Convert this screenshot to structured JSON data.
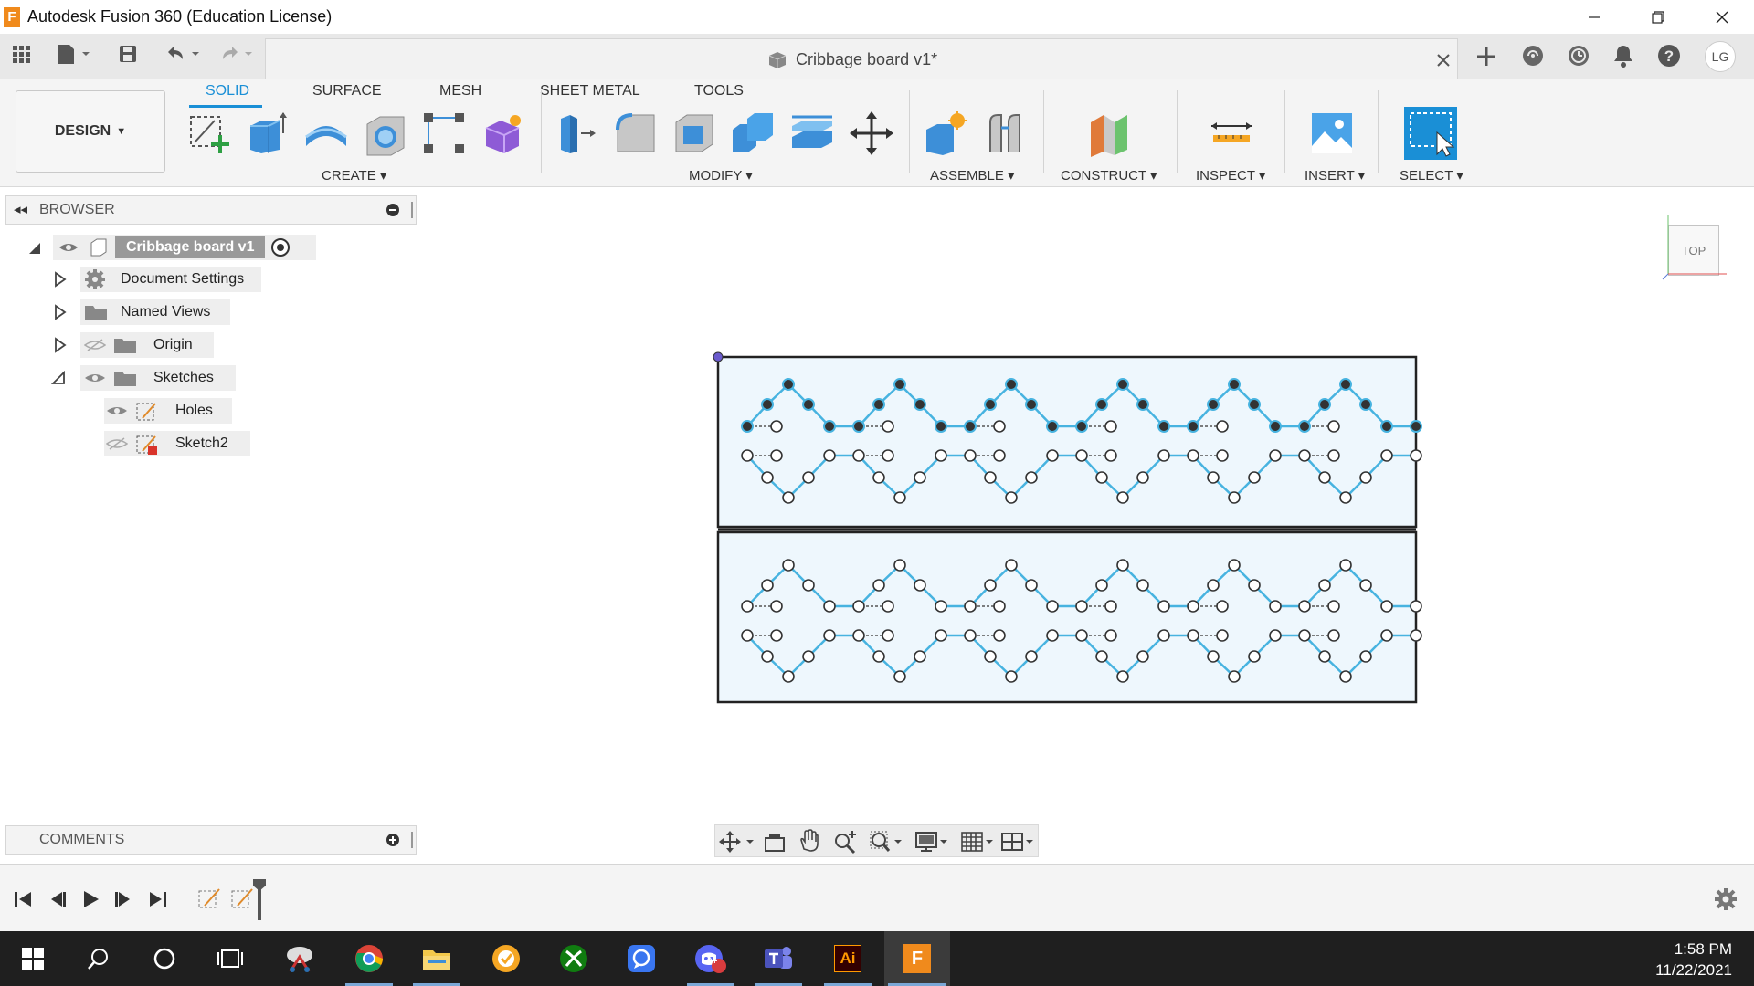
{
  "window": {
    "title": "Autodesk Fusion 360 (Education License)",
    "logo_letter": "F"
  },
  "document": {
    "tab_title": "Cribbage board v1*"
  },
  "quick_access": {
    "user_initials": "LG"
  },
  "ribbon": {
    "tabs": [
      "SOLID",
      "SURFACE",
      "MESH",
      "SHEET METAL",
      "TOOLS"
    ],
    "active_tab": "SOLID",
    "workspace": "DESIGN",
    "groups": [
      "CREATE",
      "MODIFY",
      "ASSEMBLE",
      "CONSTRUCT",
      "INSPECT",
      "INSERT",
      "SELECT"
    ]
  },
  "browser": {
    "title": "BROWSER",
    "root": "Cribbage board v1",
    "items": [
      "Document Settings",
      "Named Views",
      "Origin",
      "Sketches"
    ],
    "sketches": [
      "Holes",
      "Sketch2"
    ]
  },
  "viewcube": {
    "face": "TOP"
  },
  "comments": {
    "title": "COMMENTS"
  },
  "taskbar": {
    "time": "1:58 PM",
    "date": "11/22/2021",
    "apps": [
      "start-icon",
      "search-icon",
      "cortana-icon",
      "task-view-icon",
      "snip-icon",
      "chrome-icon",
      "file-explorer-icon",
      "norton-icon",
      "xbox-icon",
      "signal-icon",
      "discord-icon",
      "teams-icon",
      "illustrator-icon",
      "fusion-icon"
    ],
    "discord_badge": "9+",
    "illustrator_label": "Ai"
  },
  "colors": {
    "accent": "#1a8fd6",
    "sketch_line": "#47b3e0",
    "board_fill": "#eef7fd"
  }
}
